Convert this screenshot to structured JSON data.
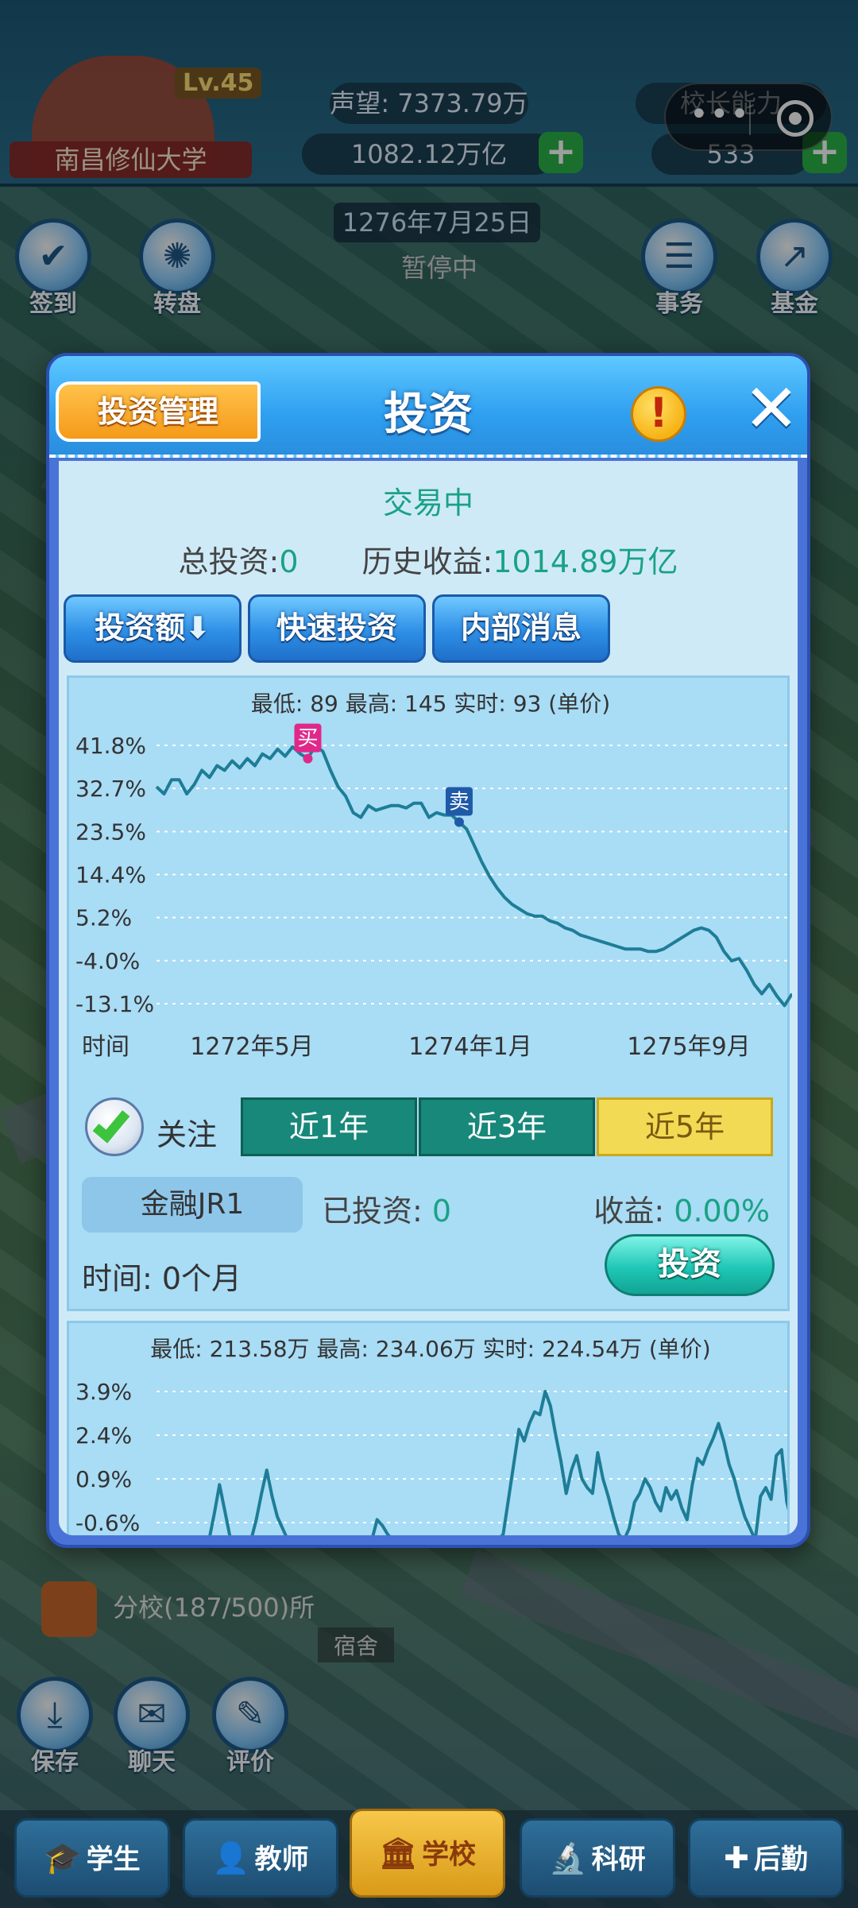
{
  "hud": {
    "school_name": "南昌修仙大学",
    "level": "Lv.45",
    "reputation": "声望: 7373.79万",
    "money": "1082.12万亿",
    "school_ability": "校长能力",
    "gems": "533",
    "date": "1276年7月25日",
    "status": "暂停中",
    "plus": "+",
    "menu_dots": "•••"
  },
  "side_buttons": {
    "left": [
      {
        "label": "签到",
        "icon": "calendar-check-icon"
      },
      {
        "label": "转盘",
        "icon": "wheel-icon"
      }
    ],
    "right": [
      {
        "label": "事务",
        "icon": "clipboard-icon"
      },
      {
        "label": "基金",
        "icon": "chart-up-icon"
      }
    ],
    "bottom": [
      {
        "label": "保存",
        "icon": "download-icon"
      },
      {
        "label": "聊天",
        "icon": "chat-icon"
      },
      {
        "label": "评价",
        "icon": "edit-icon"
      }
    ]
  },
  "map": {
    "branch": "分校(187/500)所",
    "dorm": "宿舍"
  },
  "modal": {
    "title": "投资",
    "manage_button": "投资管理",
    "info_button": "!",
    "close_button": "✕",
    "trade_status": "交易中",
    "total_investment_label": "总投资:",
    "total_investment_value": "0",
    "history_profit_label": "历史收益:",
    "history_profit_value": "1014.89万亿",
    "buttons": {
      "amount": "投资额",
      "amount_icon": "arrow-down-icon",
      "quick": "快速投资",
      "insider": "内部消息"
    },
    "chart1_stats": "最低: 89  最高: 145  实时: 93 (单价)",
    "follow_label": "关注",
    "ranges": [
      "近1年",
      "近3年",
      "近5年"
    ],
    "selected_range": "近5年",
    "asset_name": "金融JR1",
    "invested_label": "已投资:",
    "invested_value": "0",
    "profit_label": "收益:",
    "profit_value": "0.00%",
    "duration": "时间: 0个月",
    "invest_button": "投资",
    "chart2_stats": "最低: 213.58万 最高: 234.06万 实时: 224.54万 (单价)"
  },
  "tabs": [
    {
      "label": "学生",
      "icon": "graduation-cap-icon"
    },
    {
      "label": "教师",
      "icon": "person-icon"
    },
    {
      "label": "学校",
      "icon": "building-icon"
    },
    {
      "label": "科研",
      "icon": "microscope-icon"
    },
    {
      "label": "后勤",
      "icon": "first-aid-icon"
    }
  ],
  "active_tab": "学校",
  "chart_data": [
    {
      "type": "line",
      "title": "",
      "xlabel": "时间",
      "ylabel": "",
      "yticks": [
        "41.8%",
        "32.7%",
        "23.5%",
        "14.4%",
        "5.2%",
        "-4.0%",
        "-13.1%"
      ],
      "ylim": [
        -13.1,
        41.8
      ],
      "xticks": [
        "1272年5月",
        "1274年1月",
        "1275年9月"
      ],
      "markers": [
        {
          "label": "买",
          "at_index": 20,
          "color": "#e0288a"
        },
        {
          "label": "卖",
          "at_index": 40,
          "color": "#1f5aa8"
        }
      ],
      "series": [
        {
          "values": [
            33,
            31.5,
            34.5,
            34.5,
            31.5,
            33.5,
            36.5,
            35,
            37.5,
            36.5,
            38.5,
            37,
            39,
            37.5,
            40,
            39,
            41,
            39.5,
            41.5,
            40,
            39,
            41.8,
            40.5,
            36.5,
            33,
            31,
            27.5,
            26.5,
            29,
            28,
            28.5,
            29,
            29,
            28.5,
            29.5,
            29.5,
            26.5,
            27.5,
            27,
            27,
            25.5,
            24,
            20.5,
            17,
            14,
            11.5,
            9.5,
            8,
            7,
            6,
            5.5,
            5.5,
            4.5,
            4,
            3,
            2.5,
            1.5,
            1,
            0.5,
            0,
            -0.5,
            -1,
            -1.5,
            -1.5,
            -1.5,
            -2,
            -2,
            -1.5,
            -0.5,
            0.5,
            1.5,
            2.5,
            3,
            2.5,
            1,
            -2,
            -4,
            -3.5,
            -6,
            -9,
            -11,
            -9,
            -11.5,
            -13.5,
            -11
          ]
        }
      ]
    },
    {
      "type": "line",
      "title": "",
      "yticks": [
        "3.9%",
        "2.4%",
        "0.9%",
        "-0.6%"
      ],
      "ylim": [
        -0.6,
        3.9
      ],
      "series": [
        {
          "values": [
            -1.2,
            -1.2,
            -1.2,
            -1.2,
            -1.2,
            -1.2,
            -1.2,
            -1.2,
            -1.2,
            -1.2,
            -1.2,
            -0.3,
            0.7,
            -0.2,
            -1.1,
            -1.2,
            -1.2,
            -1.2,
            -1.2,
            -0.5,
            0.4,
            1.2,
            0.3,
            -0.4,
            -0.8,
            -1.2,
            -1.2,
            -1.2,
            -1.2,
            -1.2,
            -1.2,
            -1.2,
            -1.2,
            -1.2,
            -1.2,
            -1.2,
            -1.2,
            -1.2,
            -1.2,
            -1.2,
            -1.2,
            -1.2,
            -0.5,
            -0.7,
            -1.0,
            -1.2,
            -1.2,
            -1.2,
            -1.2,
            -1.2,
            -1.2,
            -1.2,
            -1.2,
            -1.2,
            -1.2,
            -1.2,
            -1.2,
            -1.2,
            -1.2,
            -1.2,
            -1.2,
            -1.2,
            -1.2,
            -1.2,
            -1.2,
            -1.2,
            -1.0,
            0.2,
            1.4,
            2.6,
            2.2,
            2.8,
            3.2,
            3.1,
            3.9,
            3.4,
            2.4,
            1.5,
            0.4,
            1.2,
            1.7,
            0.9,
            0.6,
            0.4,
            1.8,
            0.9,
            0.3,
            -0.4,
            -1.0,
            -1.2,
            -0.8,
            0.1,
            0.4,
            0.9,
            0.6,
            0.1,
            -0.2,
            0.6,
            0.2,
            0.5,
            -0.1,
            -0.5,
            0.7,
            1.6,
            1.4,
            1.9,
            2.3,
            2.8,
            2.2,
            1.4,
            0.9,
            0.2,
            -0.4,
            -0.8,
            -1.2,
            0.3,
            0.6,
            0.2,
            1.7,
            1.9,
            0.1,
            -0.6
          ]
        }
      ]
    }
  ]
}
